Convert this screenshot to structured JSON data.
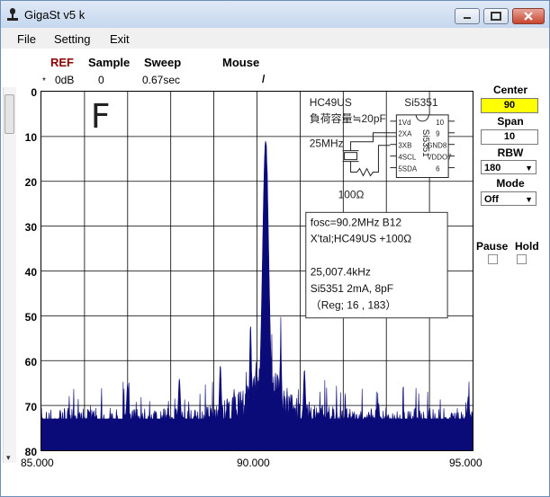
{
  "window": {
    "title": "GigaSt v5 k"
  },
  "menu": [
    "File",
    "Setting",
    "Exit"
  ],
  "header": {
    "ref_label": "REF",
    "ref_marker": "*",
    "ref_value": "0dB",
    "sample_label": "Sample",
    "sample_value": "0",
    "sweep_label": "Sweep",
    "sweep_value": "0.67sec",
    "mouse_label": "Mouse",
    "mouse_value": "/"
  },
  "controls": {
    "center_label": "Center",
    "center_value": "90",
    "span_label": "Span",
    "span_value": "10",
    "rbw_label": "RBW",
    "rbw_value": "180",
    "mode_label": "Mode",
    "mode_value": "Off",
    "pause_label": "Pause",
    "hold_label": "Hold"
  },
  "annotations": {
    "big_letter": "F",
    "xtal_type": "HC49US",
    "load_cap": "負荷容量≒20pF",
    "freq": "25MHz",
    "chip": "Si5351",
    "resistor": "100Ω",
    "chip_text": "Si5351",
    "pins_left": [
      "1Vd",
      "2XA",
      "3XB",
      "4SCL",
      "5SDA"
    ],
    "pins_right": [
      "10",
      "9",
      "GND8",
      "VDDO7",
      "6"
    ],
    "info_lines": [
      "fosc=90.2MHz B12",
      "X'tal;HC49US +100Ω",
      "",
      "25,007.4kHz",
      "Si5351 2mA, 8pF",
      "（Reg;  16 , 183）"
    ]
  },
  "icons": {
    "app": "app-icon",
    "minimize": "minimize-icon",
    "maximize": "maximize-icon",
    "close": "close-icon"
  },
  "chart_data": {
    "type": "area",
    "color": "#0a0a78",
    "x_range": [
      85.0,
      95.0
    ],
    "y_range": [
      0,
      80
    ],
    "y_inverted": true,
    "grid": true,
    "x_ticks": [
      "85.000",
      "90.000",
      "95.000"
    ],
    "y_ticks": [
      "0",
      "10",
      "20",
      "30",
      "40",
      "50",
      "60",
      "70",
      "80"
    ],
    "noise_floor_db": 73,
    "peaks": [
      {
        "x": 90.2,
        "level_db": 11
      },
      {
        "x": 89.85,
        "level_db": 52
      },
      {
        "x": 90.55,
        "level_db": 57
      },
      {
        "x": 89.15,
        "level_db": 61
      },
      {
        "x": 91.1,
        "level_db": 62
      },
      {
        "x": 87.0,
        "level_db": 65
      },
      {
        "x": 88.2,
        "level_db": 64
      },
      {
        "x": 94.9,
        "level_db": 68
      }
    ]
  }
}
